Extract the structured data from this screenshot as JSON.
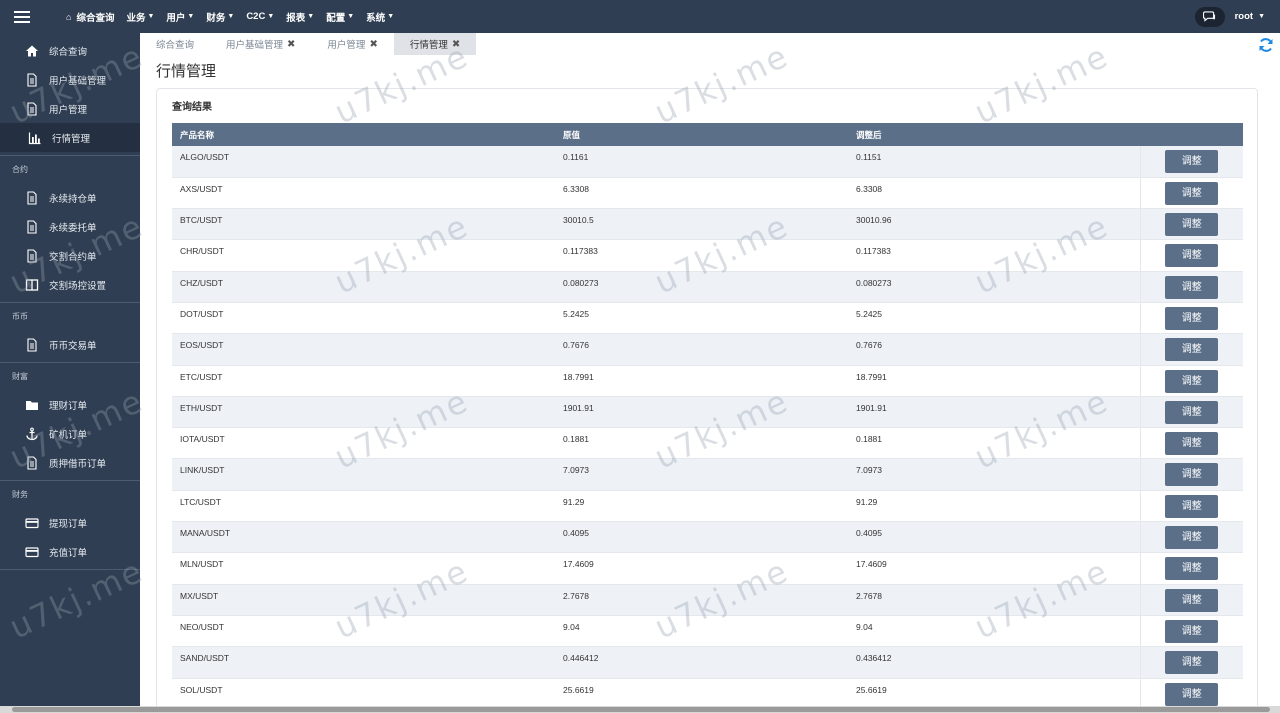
{
  "topbar": {
    "nav": [
      {
        "label": "综合查询",
        "home": true
      },
      {
        "label": "业务",
        "caret": true
      },
      {
        "label": "用户",
        "caret": true
      },
      {
        "label": "财务",
        "caret": true
      },
      {
        "label": "C2C",
        "caret": true
      },
      {
        "label": "报表",
        "caret": true
      },
      {
        "label": "配置",
        "caret": true
      },
      {
        "label": "系统",
        "caret": true
      }
    ],
    "user": "root"
  },
  "sidebar": {
    "group0": [
      {
        "label": "综合查询",
        "icon": "home-icon"
      },
      {
        "label": "用户基础管理",
        "icon": "document-icon"
      },
      {
        "label": "用户管理",
        "icon": "document-icon"
      },
      {
        "label": "行情管理",
        "icon": "bar-chart-icon",
        "active": true
      }
    ],
    "head1": "合约",
    "group1": [
      {
        "label": "永续持仓单",
        "icon": "document-icon"
      },
      {
        "label": "永续委托单",
        "icon": "document-icon"
      },
      {
        "label": "交割合约单",
        "icon": "document-icon"
      },
      {
        "label": "交割场控设置",
        "icon": "columns-icon"
      }
    ],
    "head2": "币币",
    "group2": [
      {
        "label": "币币交易单",
        "icon": "document-icon"
      }
    ],
    "head3": "财富",
    "group3": [
      {
        "label": "理财订单",
        "icon": "folder-icon"
      },
      {
        "label": "矿机订单",
        "icon": "anchor-icon"
      },
      {
        "label": "质押借币订单",
        "icon": "document-icon"
      }
    ],
    "head4": "财务",
    "group4": [
      {
        "label": "提现订单",
        "icon": "credit-card-icon"
      },
      {
        "label": "充值订单",
        "icon": "credit-card-icon"
      }
    ]
  },
  "tabs": [
    {
      "label": "综合查询",
      "closable": false,
      "active": false
    },
    {
      "label": "用户基础管理",
      "closable": true,
      "active": false
    },
    {
      "label": "用户管理",
      "closable": true,
      "active": false
    },
    {
      "label": "行情管理",
      "closable": true,
      "active": true
    }
  ],
  "page": {
    "title": "行情管理",
    "panel_title": "查询结果",
    "columns": [
      "产品名称",
      "原值",
      "调整后",
      ""
    ],
    "action_label": "调整",
    "rows": [
      [
        "ALGO/USDT",
        "0.1161",
        "0.1151"
      ],
      [
        "AXS/USDT",
        "6.3308",
        "6.3308"
      ],
      [
        "BTC/USDT",
        "30010.5",
        "30010.96"
      ],
      [
        "CHR/USDT",
        "0.117383",
        "0.117383"
      ],
      [
        "CHZ/USDT",
        "0.080273",
        "0.080273"
      ],
      [
        "DOT/USDT",
        "5.2425",
        "5.2425"
      ],
      [
        "EOS/USDT",
        "0.7676",
        "0.7676"
      ],
      [
        "ETC/USDT",
        "18.7991",
        "18.7991"
      ],
      [
        "ETH/USDT",
        "1901.91",
        "1901.91"
      ],
      [
        "IOTA/USDT",
        "0.1881",
        "0.1881"
      ],
      [
        "LINK/USDT",
        "7.0973",
        "7.0973"
      ],
      [
        "LTC/USDT",
        "91.29",
        "91.29"
      ],
      [
        "MANA/USDT",
        "0.4095",
        "0.4095"
      ],
      [
        "MLN/USDT",
        "17.4609",
        "17.4609"
      ],
      [
        "MX/USDT",
        "2.7678",
        "2.7678"
      ],
      [
        "NEO/USDT",
        "9.04",
        "9.04"
      ],
      [
        "SAND/USDT",
        "0.446412",
        "0.436412"
      ],
      [
        "SOL/USDT",
        "25.6619",
        "25.6619"
      ]
    ]
  },
  "watermark": "u7kj.me",
  "colors": {
    "topbar": "#2f3e52",
    "sidebar": "#2f3e52",
    "table_header": "#5b6f88",
    "button": "#5b6f88",
    "refresh": "#1e88e5"
  }
}
